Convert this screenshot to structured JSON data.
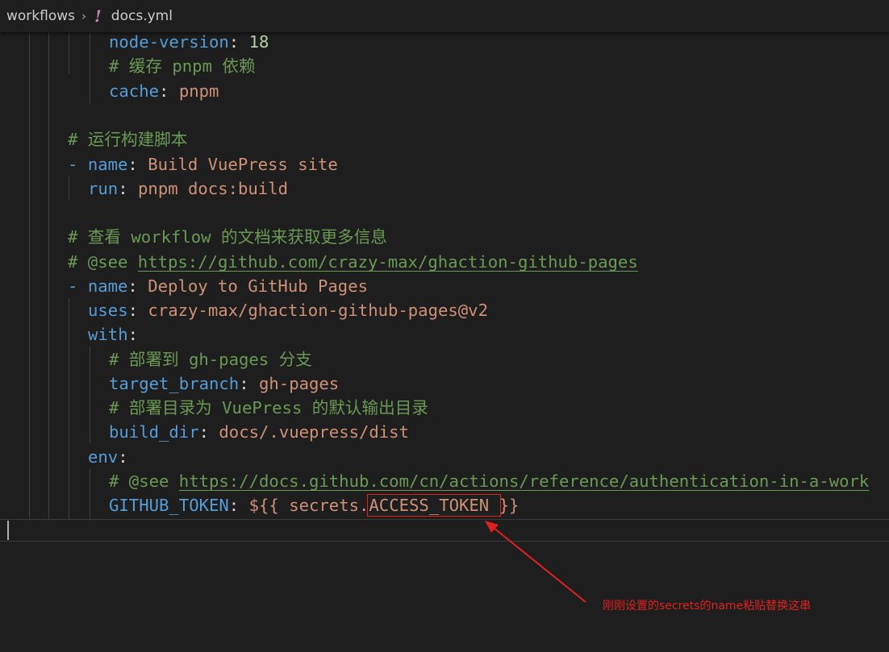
{
  "breadcrumb": {
    "folder": "workflows",
    "separator": "›",
    "file_icon_glyph": "!",
    "file": "docs.yml"
  },
  "code": {
    "l1": {
      "key": "node-version",
      "colon": ": ",
      "value": "18"
    },
    "l2": {
      "text": "# 缓存 pnpm 依赖"
    },
    "l3": {
      "key": "cache",
      "colon": ": ",
      "value": "pnpm"
    },
    "l5": {
      "text": "# 运行构建脚本"
    },
    "l6": {
      "dash": "- ",
      "key": "name",
      "colon": ": ",
      "value": "Build VuePress site"
    },
    "l7": {
      "key": "run",
      "colon": ": ",
      "value": "pnpm docs:build"
    },
    "l9": {
      "text": "# 查看 workflow 的文档来获取更多信息"
    },
    "l10": {
      "prefix": "# @see ",
      "url": "https://github.com/crazy-max/ghaction-github-pages"
    },
    "l11": {
      "dash": "- ",
      "key": "name",
      "colon": ": ",
      "value": "Deploy to GitHub Pages"
    },
    "l12": {
      "key": "uses",
      "colon": ": ",
      "value": "crazy-max/ghaction-github-pages@v2"
    },
    "l13": {
      "key": "with",
      "colon": ":"
    },
    "l14": {
      "text": "# 部署到 gh-pages 分支"
    },
    "l15": {
      "key": "target_branch",
      "colon": ": ",
      "value": "gh-pages"
    },
    "l16": {
      "text": "# 部署目录为 VuePress 的默认输出目录"
    },
    "l17": {
      "key": "build_dir",
      "colon": ": ",
      "value": "docs/.vuepress/dist"
    },
    "l18": {
      "key": "env",
      "colon": ":"
    },
    "l19": {
      "prefix": "# @see ",
      "url": "https://docs.github.com/cn/actions/reference/authentication-in-a-work"
    },
    "l20": {
      "key": "GITHUB_TOKEN",
      "colon": ": ",
      "open": "${{ secrets.",
      "token": "ACCESS_TOKEN ",
      "close": "}}"
    }
  },
  "annotation": {
    "text": "刚刚设置的secrets的name粘贴替换这串",
    "color": "#e0211f"
  },
  "colors": {
    "background": "#1e1e1e",
    "key": "#569cd6",
    "string": "#ce9178",
    "number": "#b5cea8",
    "comment": "#6a9955"
  }
}
